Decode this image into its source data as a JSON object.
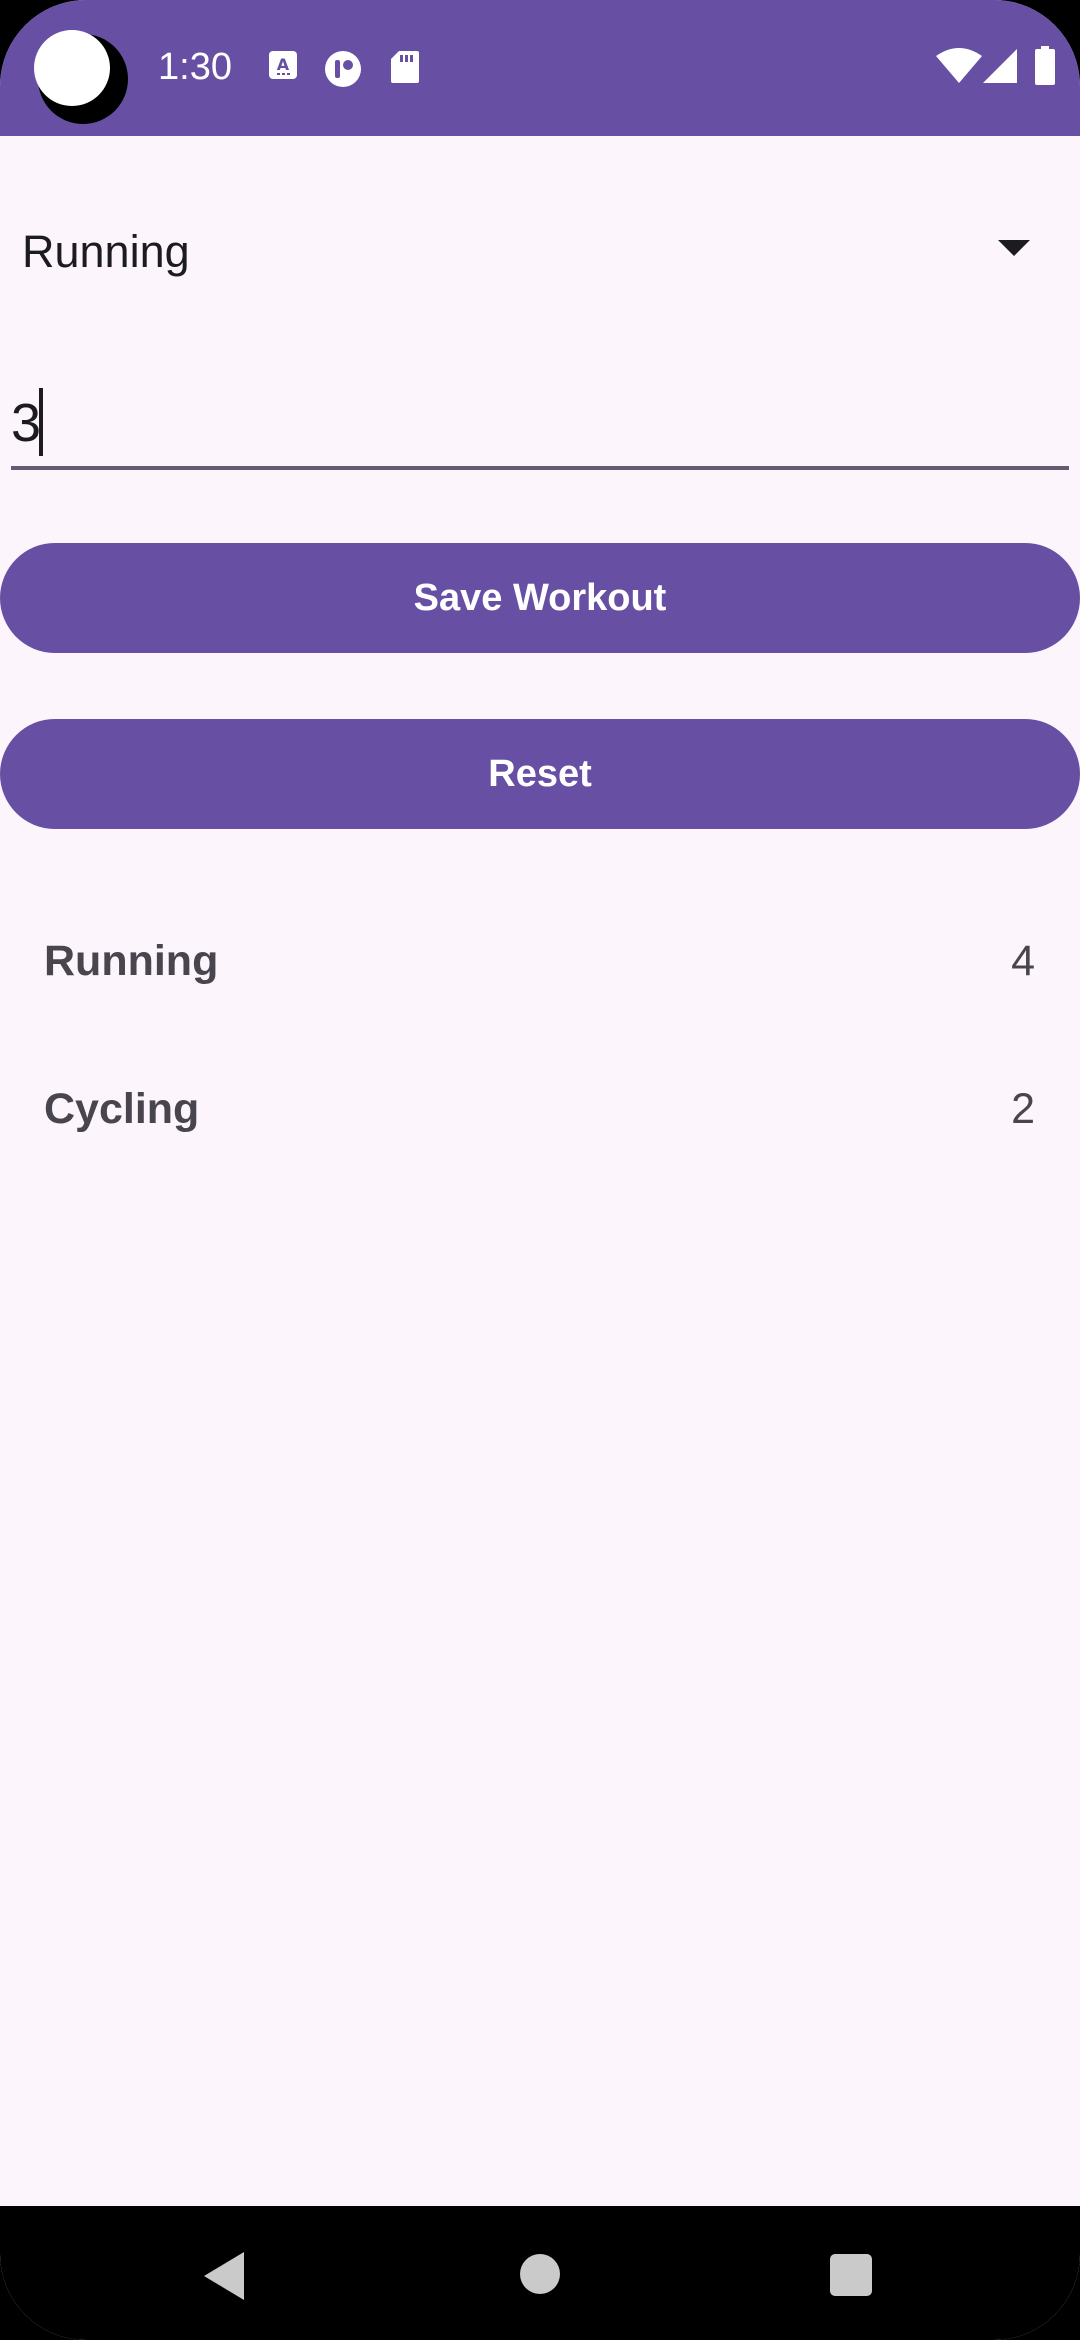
{
  "status_bar": {
    "time": "1:30",
    "icons": [
      "text-a-icon",
      "app-circle-icon",
      "sd-card-icon",
      "wifi-icon",
      "signal-icon",
      "battery-icon"
    ]
  },
  "form": {
    "workout_type": "Running",
    "duration_value": "3"
  },
  "buttons": {
    "save_label": "Save Workout",
    "reset_label": "Reset"
  },
  "workouts": [
    {
      "name": "Running",
      "count": "4"
    },
    {
      "name": "Cycling",
      "count": "2"
    }
  ],
  "nav_bar": {
    "icons": [
      "back-icon",
      "home-icon",
      "recents-icon"
    ]
  },
  "colors": {
    "primary": "#6750A4",
    "background": "#FDF5FC",
    "text": "#1C1B1F",
    "secondary_text": "#49454F"
  }
}
